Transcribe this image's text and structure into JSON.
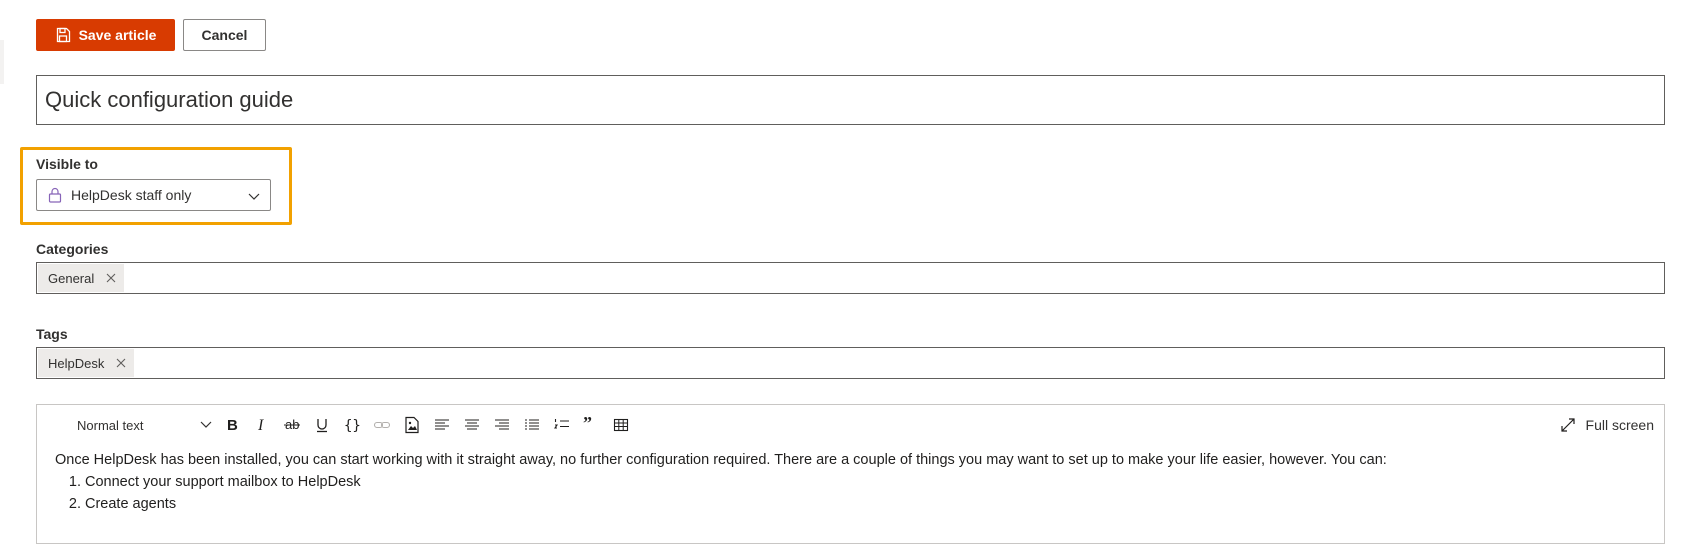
{
  "actions": {
    "save_label": "Save article",
    "cancel_label": "Cancel"
  },
  "title_field": {
    "value": "Quick configuration guide"
  },
  "visibility": {
    "label": "Visible to",
    "value": "HelpDesk staff only",
    "icon": "lock-icon"
  },
  "categories": {
    "label": "Categories",
    "chips": [
      {
        "label": "General"
      }
    ]
  },
  "tags": {
    "label": "Tags",
    "chips": [
      {
        "label": "HelpDesk"
      }
    ]
  },
  "editor": {
    "style_value": "Normal text",
    "fullscreen_label": "Full screen",
    "toolbar_icons": [
      "bold-icon",
      "italic-icon",
      "strikethrough-icon",
      "underline-icon",
      "code-icon",
      "link-icon",
      "image-icon",
      "align-left-icon",
      "align-center-icon",
      "align-right-icon",
      "bulleted-list-icon",
      "numbered-list-icon",
      "quote-icon",
      "table-icon"
    ],
    "body_paragraph": "Once HelpDesk has been installed, you can start working with it straight away, no further configuration required. There are a couple of things you may want to set up to make your life easier, however. You can:",
    "list_items": [
      "Connect your support mailbox to HelpDesk",
      "Create agents"
    ]
  },
  "colors": {
    "primary": "#d83b01",
    "highlight": "#f2a100",
    "lock": "#8764b8"
  }
}
